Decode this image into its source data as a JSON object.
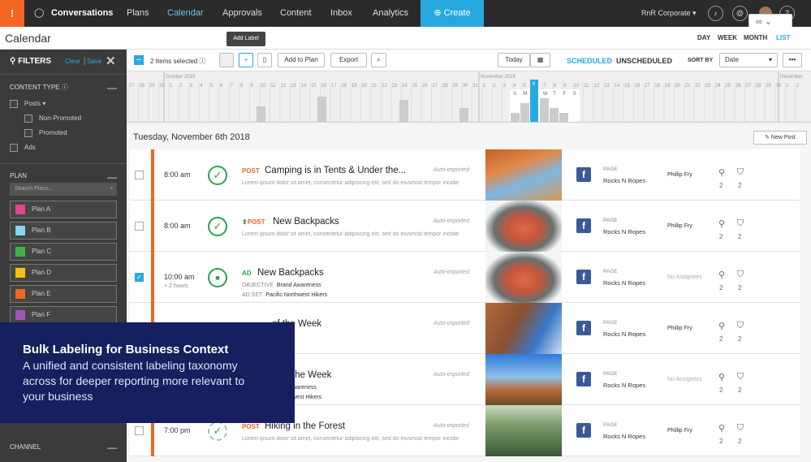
{
  "nav": {
    "logo": "⁝",
    "items": [
      "Conversations",
      "Plans",
      "Calendar",
      "Approvals",
      "Content",
      "Inbox",
      "Analytics"
    ],
    "create_label": "Create",
    "account": "RnR Corporate",
    "chat_icon": "chat-bubble-icon",
    "bell_icon": "bell-icon",
    "at_icon": "at-icon",
    "help_icon": "help-icon"
  },
  "subheader": {
    "title": "Calendar",
    "views": [
      "DAY",
      "WEEK",
      "MONTH",
      "LIST"
    ],
    "selected_view": "LIST"
  },
  "tooltip": "Add Label",
  "sidebar": {
    "filters_label": "FILTERS",
    "clear": "Clear",
    "save": "Save",
    "content_type_label": "CONTENT TYPE",
    "posts": "Posts",
    "non_promoted": "Non-Promoted",
    "promoted": "Promoted",
    "ads": "Ads",
    "plan_label": "PLAN",
    "search_placeholder": "Search Plans...",
    "plans": [
      {
        "name": "Plan A",
        "color": "#e0458a"
      },
      {
        "name": "Plan B",
        "color": "#7fd8f0"
      },
      {
        "name": "Plan C",
        "color": "#3cb44b"
      },
      {
        "name": "Plan D",
        "color": "#f4c20d"
      },
      {
        "name": "Plan E",
        "color": "#f26622"
      },
      {
        "name": "Plan F",
        "color": "#9b59b6"
      }
    ],
    "channel_label": "CHANNEL"
  },
  "toolbar": {
    "selected_text": "2 Items selected",
    "add_to_plan": "Add to Plan",
    "export": "Export",
    "today": "Today",
    "scheduled": "SCHEDULED",
    "unscheduled": "UNSCHEDULED",
    "sort_by": "SORT BY",
    "sort_value": "Date"
  },
  "timeline": {
    "month_labels": [
      "October 2018",
      "November 2018",
      "December"
    ],
    "day_numbers": "27 28 29 30 1 2 3 4 5 6 7 8 9 10 11 12 13 14 15 16 17 18 19 20 21 22 23 24 25 26 27 28 29 30 31 1 2 3 4 5 6 7 8 9 10 11 12 13 14 15 16 17 18 19 20 21 22 23 24 25 26 27 28 29 30 1 2",
    "week_letters": [
      "S",
      "M",
      "T",
      "W",
      "T",
      "F",
      "S"
    ],
    "highlight_day": "6"
  },
  "date_heading": "Tuesday, November 6th 2018",
  "new_post": "New Post",
  "rows": [
    {
      "time": "8:00 am",
      "duration": "",
      "type": "POST",
      "title": "Camping is in Tents & Under the...",
      "desc": "Lorem ipsum dolor sit amet, consectetur adipiscing elit, sed do eiusmod tempor incidie",
      "auto": "Auto-imported",
      "page_label": "PAGE",
      "page": "Rocks N Ropes",
      "assignee": "Phillip Fry",
      "pins": "2",
      "tags": "2",
      "checked": false,
      "status": "check"
    },
    {
      "time": "8:00 am",
      "duration": "",
      "type": "POST",
      "title": "New Backpacks",
      "desc": "Lorem ipsum dolor sit amet, consectetur adipiscing elit, sed do eiusmod tempor incidie",
      "auto": "Auto-imported",
      "page_label": "PAGE",
      "page": "Rocks N Ropes",
      "assignee": "Phillip Fry",
      "pins": "2",
      "tags": "2",
      "checked": false,
      "status": "check"
    },
    {
      "time": "10:00 am",
      "duration": "+ 2 hours",
      "type": "AD",
      "title": "New Backpacks",
      "objective_label": "OBJECTIVE",
      "objective": "Brand Awareness",
      "adset_label": "AD SET",
      "adset": "Pacific Northwest Hikers",
      "auto": "Auto-imported",
      "page_label": "PAGE",
      "page": "Rocks N Ropes",
      "assignee": "No Assignees",
      "pins": "2",
      "tags": "2",
      "checked": true,
      "status": "stop"
    },
    {
      "time": "",
      "duration": "",
      "type": "",
      "title": "of the Week",
      "desc": "",
      "auto": "Auto-imported",
      "page_label": "PAGE",
      "page": "Rocks N Ropes",
      "assignee": "Phillip Fry",
      "pins": "2",
      "tags": "2",
      "checked": false,
      "status": ""
    },
    {
      "time": "",
      "duration": "",
      "type": "",
      "title": "the Week",
      "desc": "wareness",
      "desc2": "west Hikers",
      "auto": "Auto-imported",
      "page_label": "PAGE",
      "page": "Rocks N Ropes",
      "assignee": "No Assignees",
      "pins": "2",
      "tags": "2",
      "checked": false,
      "status": ""
    },
    {
      "time": "7:00 pm",
      "duration": "",
      "type": "POST",
      "title": "Hiking in the Forest",
      "desc": "Lorem ipsum dolor sit amet, consectetur adipiscing elit, sed do eiusmod tempor incidie",
      "auto": "Auto-imported",
      "page_label": "PAGE",
      "page": "Rocks N Ropes",
      "assignee": "Phillip Fry",
      "pins": "2",
      "tags": "2",
      "checked": false,
      "status": "dash"
    }
  ],
  "overlay": {
    "heading": "Bulk Labeling for Business Context",
    "body": "A unified and consistent labeling taxonomy across for deeper reporting more relevant to your business"
  }
}
